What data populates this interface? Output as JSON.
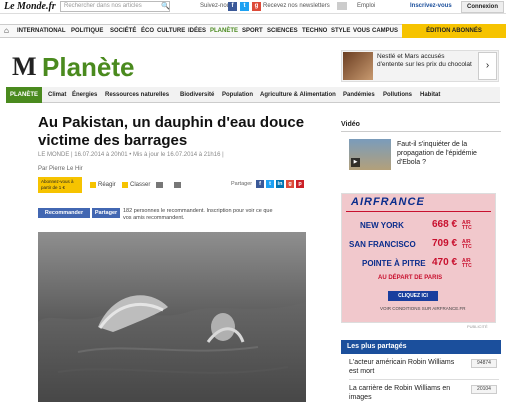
{
  "topbar": {
    "logo": "Le Monde.fr",
    "search_placeholder": "Rechercher dans nos articles",
    "follow_label": "Suivez-nous",
    "newsletter_label": "Recevez nos newsletters",
    "emploi_label": "Emploi",
    "inscrivez_label": "Inscrivez-vous",
    "connexion_label": "Connexion"
  },
  "mainnav": {
    "items": [
      "INTERNATIONAL",
      "POLITIQUE",
      "SOCIÉTÉ",
      "ÉCO",
      "CULTURE",
      "IDÉES",
      "PLANÈTE",
      "SPORT",
      "SCIENCES",
      "TECHNO",
      "STYLE",
      "VOUS",
      "CAMPUS"
    ],
    "abonnes_label": "ÉDITION ABONNÉS"
  },
  "section": {
    "title": "Planète"
  },
  "promo": {
    "text": "Nestlé et Mars accusés d'entente sur les prix du chocolat"
  },
  "subnav": {
    "active": "PLANÈTE",
    "items": [
      "Climat",
      "Énergies",
      "Ressources naturelles",
      "Biodiversité",
      "Population",
      "Agriculture & Alimentation",
      "Pandémies",
      "Pollutions",
      "Habitat"
    ]
  },
  "article": {
    "headline": "Au Pakistan, un dauphin d'eau douce victime des barrages",
    "meta": "LE MONDE | 16.07.2014 à 20h01 • Mis à jour le 16.07.2014 à 21h16 |",
    "author": "Par Pierre Le Hir",
    "abo_box": "Abonnez-vous à partir de 1 €",
    "reagir": "Réagir",
    "classer": "Classer",
    "partager": "Partager",
    "recommander": "Recommander",
    "partager_btn": "Partager",
    "rec_text": "182 personnes le recommandent. Inscription pour voir ce que vos amis recommandent."
  },
  "sidebar": {
    "video_header": "Vidéo",
    "video_title": "Faut-il s'inquiéter de la propagation de l'épidémie d'Ebola ?",
    "ad": {
      "brand": "AIRFRANCE",
      "routes": [
        {
          "city": "NEW YORK",
          "price": "668 €"
        },
        {
          "city": "SAN FRANCISCO",
          "price": "709 €"
        },
        {
          "city": "POINTE À PITRE",
          "price": "470 €"
        }
      ],
      "price_suffix": "A/R TTC",
      "depart": "AU DÉPART DE PARIS",
      "cta": "CLIQUEZ ICI",
      "voir": "VOIR CONDITIONS SUR AIRFRANCE.FR",
      "pub": "PUBLICITÉ"
    },
    "plus_header": "Les plus partagés",
    "plus_items": [
      {
        "text": "L'acteur américain Robin Williams est mort",
        "count": "94874"
      },
      {
        "text": "La carrière de Robin Williams en images",
        "count": "20104"
      }
    ]
  },
  "colors": {
    "planete_green": "#4a8a1e",
    "lemonde_blue": "#1b4f9c",
    "abonnes_yellow": "#f6c300"
  }
}
